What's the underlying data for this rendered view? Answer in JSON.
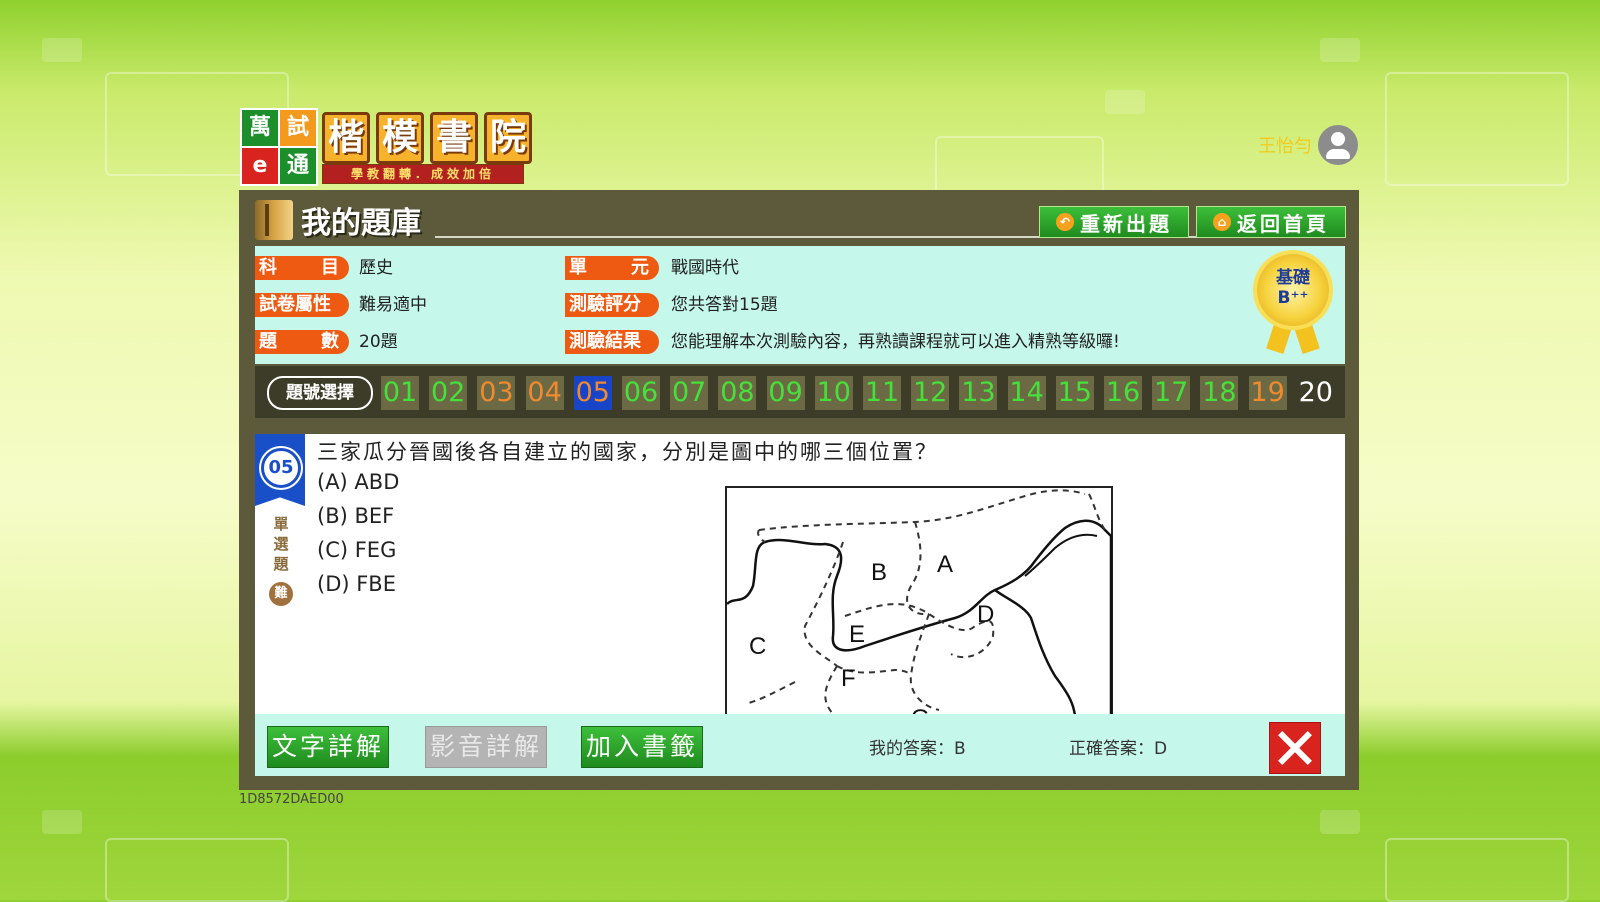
{
  "header": {
    "logo": {
      "box_chars": [
        "萬",
        "試",
        "e",
        "通"
      ],
      "title_chars": [
        "楷",
        "模",
        "書",
        "院"
      ],
      "slogan": "學教翻轉．成效加倍"
    },
    "user_name": "王怡勻"
  },
  "panel": {
    "title": "我的題庫",
    "buttons": {
      "retry": "重新出題",
      "home": "返回首頁"
    }
  },
  "info": {
    "subject_label": [
      "科",
      "目"
    ],
    "subject": "歷史",
    "unit_label": [
      "單",
      "元"
    ],
    "unit": "戰國時代",
    "attr_label": "試卷屬性",
    "attr": "難易適中",
    "score_label": "測驗評分",
    "score": "您共答對15題",
    "count_label": [
      "題",
      "數"
    ],
    "count": "20題",
    "result_label": "測驗結果",
    "result": "您能理解本次測驗內容，再熟讀課程就可以進入精熟等級囉!",
    "badge": {
      "line1": "基礎",
      "line2": "B⁺⁺"
    }
  },
  "question_nav": {
    "label": "題號選擇",
    "numbers": [
      "01",
      "02",
      "03",
      "04",
      "05",
      "06",
      "07",
      "08",
      "09",
      "10",
      "11",
      "12",
      "13",
      "14",
      "15",
      "16",
      "17",
      "18",
      "19",
      "20"
    ],
    "status": [
      "correct",
      "correct",
      "wrong",
      "wrong",
      "current",
      "correct",
      "correct",
      "correct",
      "correct",
      "correct",
      "correct",
      "correct",
      "correct",
      "correct",
      "correct",
      "correct",
      "correct",
      "correct",
      "wrong",
      "plain"
    ]
  },
  "question": {
    "number": "05",
    "type": "單選題",
    "difficulty": "難",
    "text": "三家瓜分晉國後各自建立的國家，分別是圖中的哪三個位置？",
    "options": [
      "(A)  ABD",
      "(B)  BEF",
      "(C)  FEG",
      "(D)  FBE"
    ],
    "map_labels": [
      "A",
      "B",
      "C",
      "D",
      "E",
      "F",
      "G"
    ]
  },
  "bottom": {
    "text_explain": "文字詳解",
    "video_explain": "影音詳解",
    "bookmark": "加入書籤",
    "my_answer": "我的答案：B",
    "correct_answer": "正確答案：D"
  },
  "footer_code": "1D8572DAED00"
}
